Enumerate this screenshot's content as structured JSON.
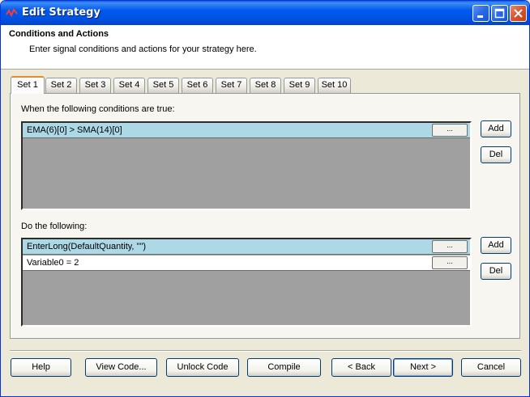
{
  "window": {
    "title": "Edit Strategy"
  },
  "header": {
    "title": "Conditions and Actions",
    "subtitle": "Enter signal conditions and actions for your strategy here."
  },
  "tabs": [
    {
      "label": "Set 1",
      "active": true
    },
    {
      "label": "Set 2"
    },
    {
      "label": "Set 3"
    },
    {
      "label": "Set 4"
    },
    {
      "label": "Set 5"
    },
    {
      "label": "Set 6"
    },
    {
      "label": "Set 7"
    },
    {
      "label": "Set 8"
    },
    {
      "label": "Set 9"
    },
    {
      "label": "Set 10"
    }
  ],
  "conditions": {
    "label": "When the following conditions are true:",
    "items": [
      {
        "text": "EMA(6)[0] > SMA(14)[0]",
        "button": "..."
      }
    ],
    "add_label": "Add",
    "del_label": "Del"
  },
  "actions": {
    "label": "Do the following:",
    "items": [
      {
        "text": "EnterLong(DefaultQuantity, \"\")",
        "button": "..."
      },
      {
        "text": "Variable0 = 2",
        "button": "..."
      }
    ],
    "add_label": "Add",
    "del_label": "Del"
  },
  "footer": {
    "help": "Help",
    "view_code": "View Code...",
    "unlock_code": "Unlock Code",
    "compile": "Compile",
    "back": "< Back",
    "next": "Next >",
    "cancel": "Cancel"
  },
  "colors": {
    "titlebar": "#0054e3",
    "selected_row": "#add8e6",
    "active_tab_accent": "#e68b2c"
  }
}
